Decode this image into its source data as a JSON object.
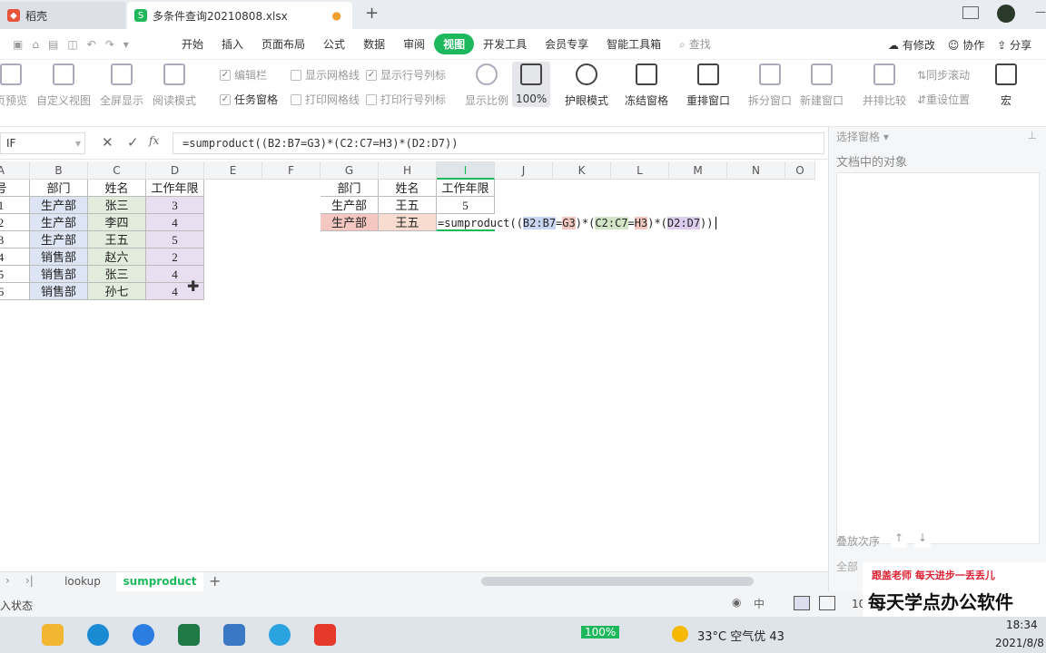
{
  "tabs": {
    "app": "稻壳",
    "file": "多条件查询20210808.xlsx",
    "add": "+"
  },
  "menu": [
    "开始",
    "插入",
    "页面布局",
    "公式",
    "数据",
    "审阅",
    "视图",
    "开发工具",
    "会员专享",
    "智能工具箱",
    "查找"
  ],
  "menu_right": {
    "modified": "有修改",
    "collab": "协作",
    "share": "分享"
  },
  "toolbar": {
    "preview": "页预览",
    "custom_view": "自定义视图",
    "fullscreen": "全屏显示",
    "read_mode": "阅读模式",
    "editbar": "编辑栏",
    "taskpane": "任务窗格",
    "show_grid": "显示网格线",
    "print_grid": "打印网格线",
    "show_rowcol": "显示行号列标",
    "print_rowcol": "打印行号列标",
    "zoom_ratio": "显示比例",
    "zoom_100": "100%",
    "eye_mode": "护眼模式",
    "freeze": "冻结窗格",
    "rearrange": "重排窗口",
    "split": "拆分窗口",
    "new_window": "新建窗口",
    "side_by_side": "并排比较",
    "sync_scroll": "同步滚动",
    "reset_pos": "重设位置",
    "macro": "宏"
  },
  "formula": {
    "namebox": "IF",
    "fx": "fx",
    "text": "=sumproduct((B2:B7=G3)*(C2:C7=H3)*(D2:D7))"
  },
  "columns": [
    "A",
    "B",
    "C",
    "D",
    "E",
    "F",
    "G",
    "H",
    "I",
    "J",
    "K",
    "L",
    "M",
    "N",
    "O"
  ],
  "table1": {
    "header": [
      "号",
      "部门",
      "姓名",
      "工作年限"
    ],
    "rows": [
      [
        "1",
        "生产部",
        "张三",
        "3"
      ],
      [
        "2",
        "生产部",
        "李四",
        "4"
      ],
      [
        "3",
        "生产部",
        "王五",
        "5"
      ],
      [
        "4",
        "销售部",
        "赵六",
        "2"
      ],
      [
        "5",
        "销售部",
        "张三",
        "4"
      ],
      [
        "6",
        "销售部",
        "孙七",
        "4"
      ]
    ]
  },
  "table2": {
    "header": [
      "部门",
      "姓名",
      "工作年限"
    ],
    "row1": [
      "生产部",
      "王五",
      "5"
    ],
    "row2": [
      "生产部",
      "王五"
    ]
  },
  "edit_formula": {
    "p1": "=sumproduct((",
    "r1": "B2:B7",
    "eq1": "=",
    "r2": "G3",
    "p2": ")*(",
    "r3": "C2:C7",
    "eq2": "=",
    "r4": "H3",
    "p3": ")*(",
    "r5": "D2:D7",
    "p4": "))"
  },
  "rpanel": {
    "title": "选择窗格",
    "objects": "文档中的对象",
    "order": "叠放次序",
    "all": "全部"
  },
  "sheets": [
    "lookup",
    "sumproduct"
  ],
  "status": {
    "left": "入状态",
    "zoom": "10"
  },
  "taskbar": {
    "battery": "100%",
    "weather": "33°C 空气优 43",
    "time": "18:34",
    "date": "2021/8/8"
  },
  "watermark": {
    "line1": "跟盖老师  每天进步一丢丢儿",
    "line2": "每天学点办公软件"
  }
}
